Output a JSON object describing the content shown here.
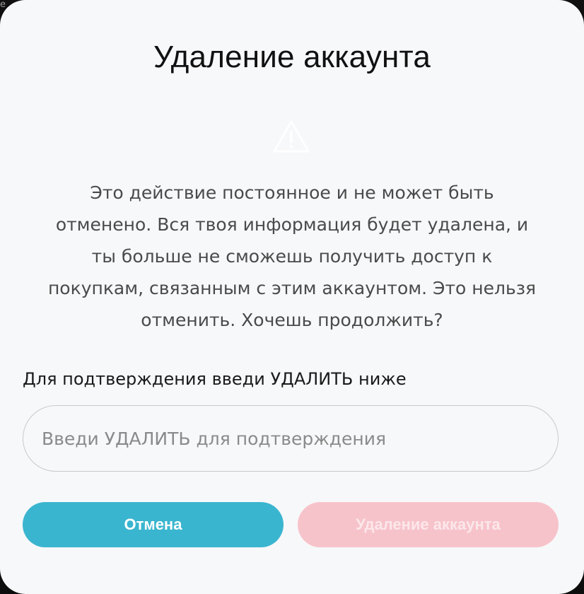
{
  "background_text": "e",
  "dialog": {
    "title": "Удаление аккаунта",
    "warning_icon": "warning-triangle-icon",
    "message_lines": [
      "Это действие постоянное и не может быть",
      "отменено. Вся твоя информация будет удалена, и",
      "ты больше не сможешь получить доступ к",
      "покупкам, связанным с этим аккаунтом. Это нельзя",
      "отменить. Хочешь продолжить?"
    ],
    "confirm_label": "Для подтверждения введи УДАЛИТЬ ниже",
    "confirm_input": {
      "value": "",
      "placeholder": "Введи УДАЛИТЬ для подтверждения"
    },
    "cancel_button": "Отмена",
    "delete_button": "Удаление аккаунта"
  },
  "colors": {
    "cancel_button_bg": "#3ab5cf",
    "delete_button_bg_disabled": "#f7c3cb",
    "dialog_bg": "#f7f8fa"
  }
}
